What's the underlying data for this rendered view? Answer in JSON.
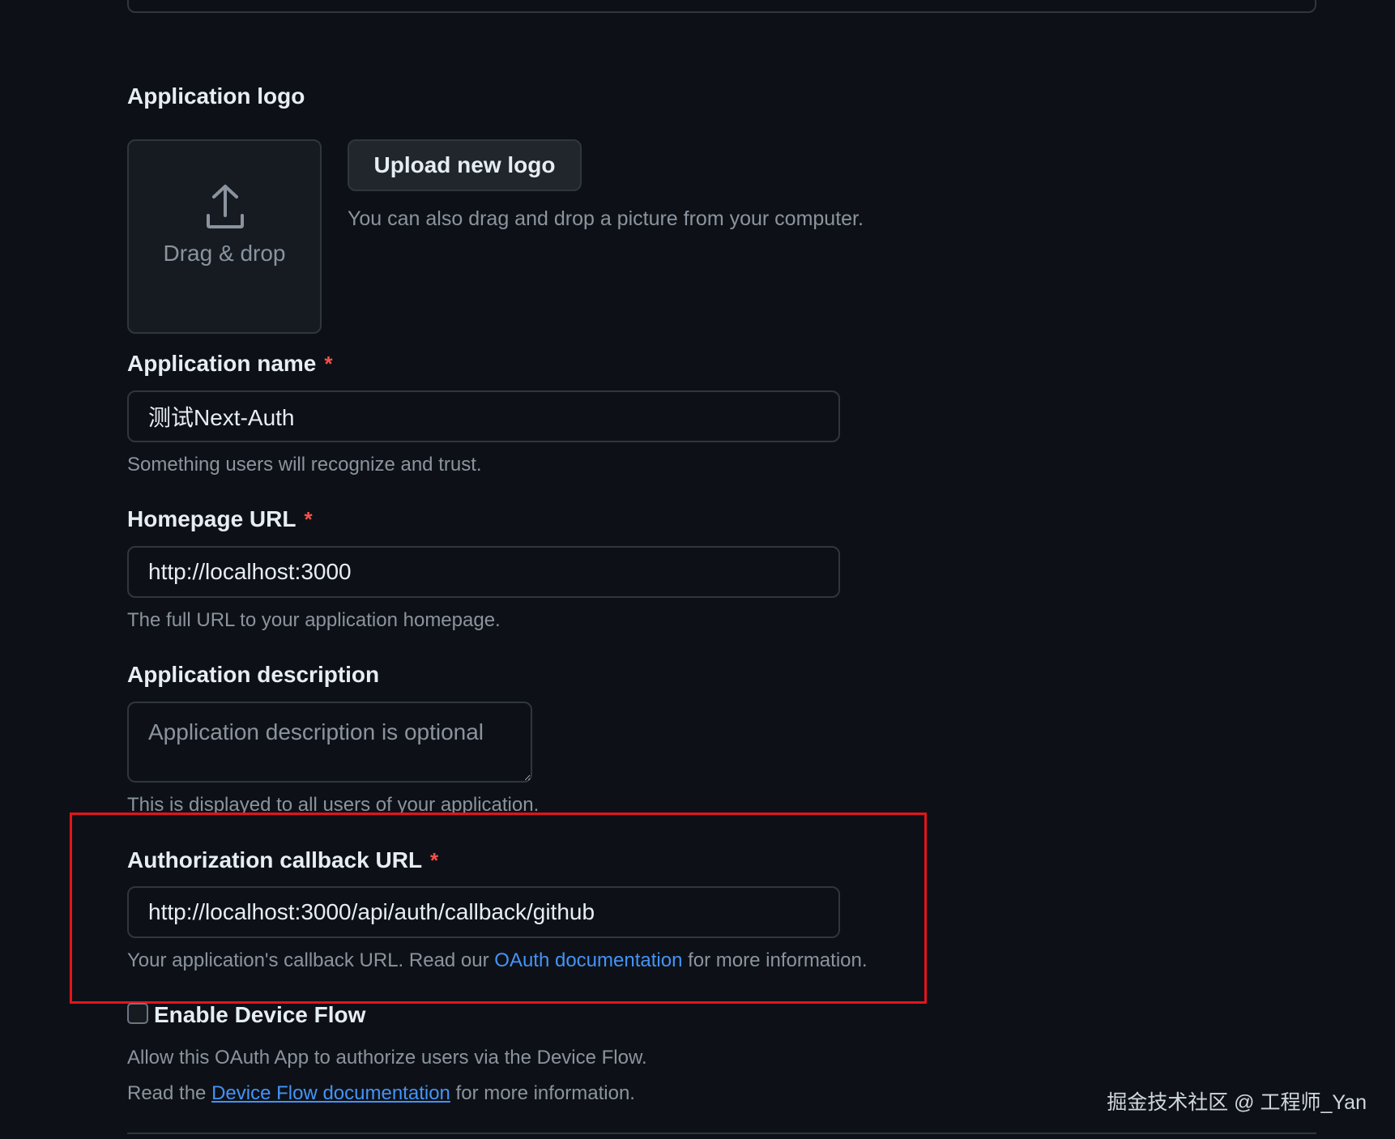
{
  "logo": {
    "label": "Application logo",
    "drop_text": "Drag & drop",
    "upload_button": "Upload new logo",
    "hint": "You can also drag and drop a picture from your computer.",
    "icon": "upload-icon"
  },
  "app_name": {
    "label": "Application name",
    "required_mark": "*",
    "value": "测试Next-Auth",
    "hint": "Something users will recognize and trust."
  },
  "homepage": {
    "label": "Homepage URL",
    "required_mark": "*",
    "value": "http://localhost:3000",
    "hint": "The full URL to your application homepage."
  },
  "description": {
    "label": "Application description",
    "placeholder": "Application description is optional",
    "hint": "This is displayed to all users of your application."
  },
  "callback": {
    "label": "Authorization callback URL",
    "required_mark": "*",
    "value": "http://localhost:3000/api/auth/callback/github",
    "hint_prefix": "Your application's callback URL. Read our ",
    "hint_link": "OAuth documentation",
    "hint_suffix": " for more information.",
    "highlight_color": "#e5141b"
  },
  "device_flow": {
    "label": "Enable Device Flow",
    "checked": false,
    "hint": "Allow this OAuth App to authorize users via the Device Flow.",
    "hint2_prefix": "Read the ",
    "hint2_link": "Device Flow documentation",
    "hint2_suffix": " for more information."
  },
  "watermark": "掘金技术社区 @ 工程师_Yan",
  "colors": {
    "background": "#0d1117",
    "border": "#30363d",
    "link": "#4493f8",
    "required": "#f85149"
  }
}
